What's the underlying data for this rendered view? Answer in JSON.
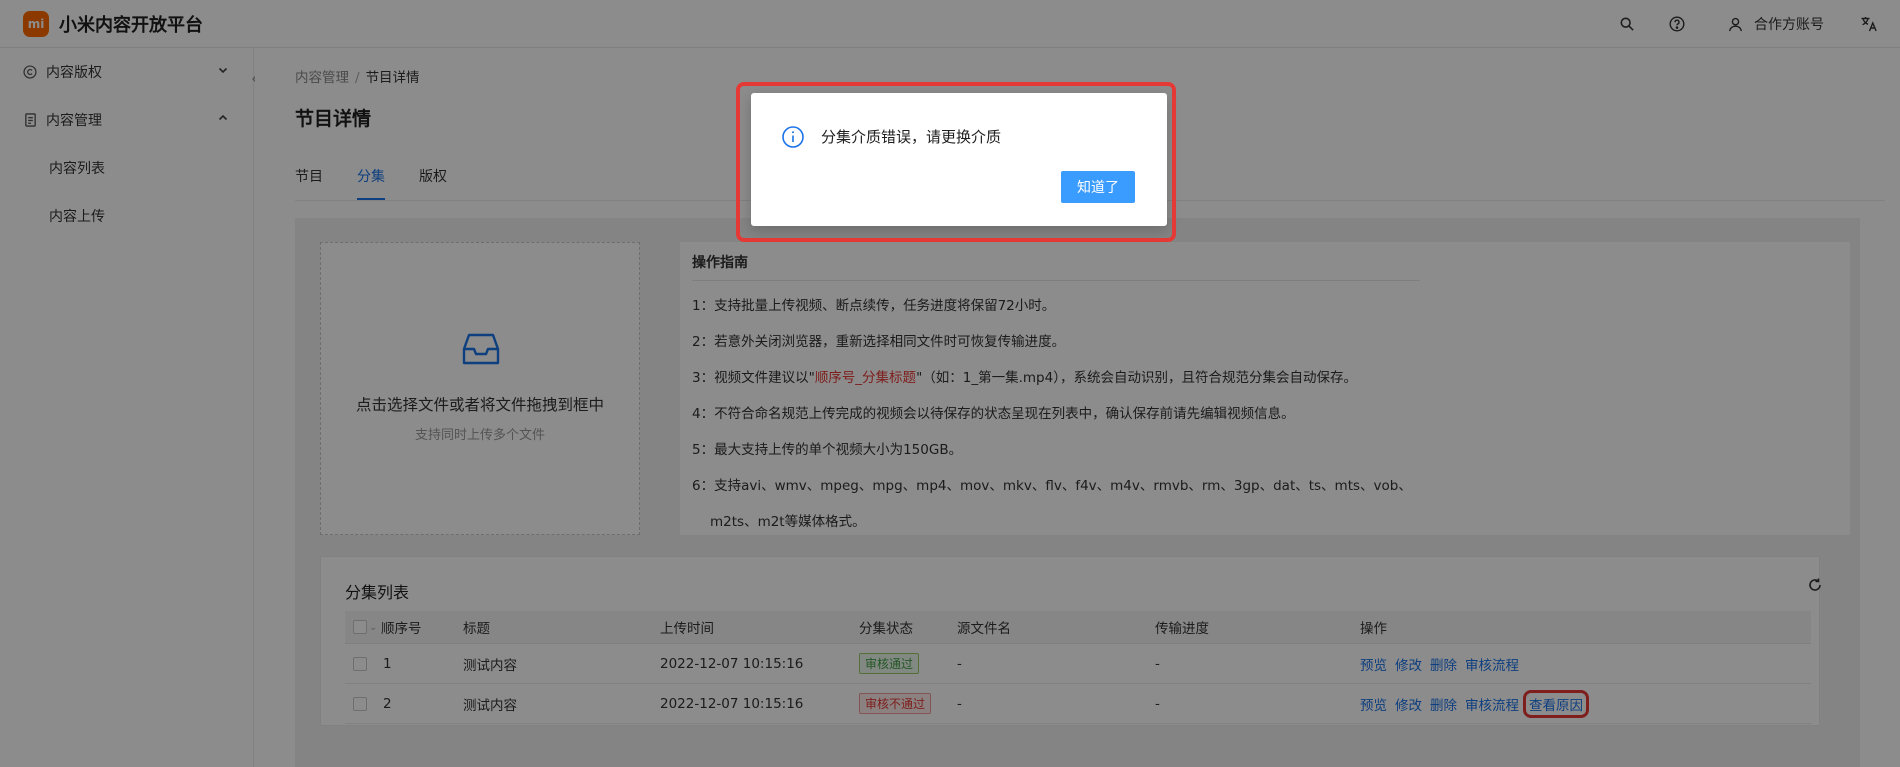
{
  "header": {
    "logo_text": "mi",
    "app_title": "小米内容开放平台",
    "account_label": "合作方账号"
  },
  "sidebar": {
    "groups": [
      {
        "label": "内容版权",
        "icon": "copyright-icon",
        "expanded": false
      },
      {
        "label": "内容管理",
        "icon": "document-icon",
        "expanded": true,
        "items": [
          {
            "label": "内容列表"
          },
          {
            "label": "内容上传"
          }
        ]
      }
    ]
  },
  "breadcrumb": {
    "parent": "内容管理",
    "separator": "/",
    "current": "节目详情"
  },
  "page_title": "节目详情",
  "tabs": [
    {
      "label": "节目",
      "active": false
    },
    {
      "label": "分集",
      "active": true
    },
    {
      "label": "版权",
      "active": false
    }
  ],
  "upload": {
    "title": "点击选择文件或者将文件拖拽到框中",
    "subtitle": "支持同时上传多个文件"
  },
  "guide": {
    "title": "操作指南",
    "items": [
      {
        "text": "1：支持批量上传视频、断点续传，任务进度将保留72小时。"
      },
      {
        "text": "2：若意外关闭浏览器，重新选择相同文件时可恢复传输进度。"
      },
      {
        "prefix": "3：视频文件建议以\"",
        "highlight": "顺序号_分集标题",
        "suffix": "\"（如：1_第一集.mp4），系统会自动识别，且符合规范分集会自动保存。"
      },
      {
        "text": "4：不符合命名规范上传完成的视频会以待保存的状态呈现在列表中，确认保存前请先编辑视频信息。"
      },
      {
        "text": "5：最大支持上传的单个视频大小为150GB。"
      },
      {
        "text": "6：支持avi、wmv、mpeg、mpg、mp4、mov、mkv、flv、f4v、m4v、rmvb、rm、3gp、dat、ts、mts、vob、"
      },
      {
        "text": "m2ts、m2t等媒体格式。"
      }
    ]
  },
  "episode_list": {
    "title": "分集列表",
    "columns": [
      "顺序号",
      "标题",
      "上传时间",
      "分集状态",
      "源文件名",
      "传输进度",
      "操作"
    ],
    "rows": [
      {
        "order": "1",
        "title": "测试内容",
        "upload_time": "2022-12-07 10:15:16",
        "status": "审核通过",
        "status_type": "ok",
        "source_file": "-",
        "progress": "-",
        "actions": [
          "预览",
          "修改",
          "删除",
          "审核流程"
        ]
      },
      {
        "order": "2",
        "title": "测试内容",
        "upload_time": "2022-12-07 10:15:16",
        "status": "审核不通过",
        "status_type": "bad",
        "source_file": "-",
        "progress": "-",
        "actions": [
          "预览",
          "修改",
          "删除",
          "审核流程",
          "查看原因"
        ]
      }
    ]
  },
  "modal": {
    "icon": "info-icon",
    "message": "分集介质错误，请更换介质",
    "confirm_label": "知道了"
  },
  "colors": {
    "accent": "#1a73e8",
    "brand": "#ff6900",
    "highlight": "#e53935",
    "button": "#3b9cff"
  }
}
